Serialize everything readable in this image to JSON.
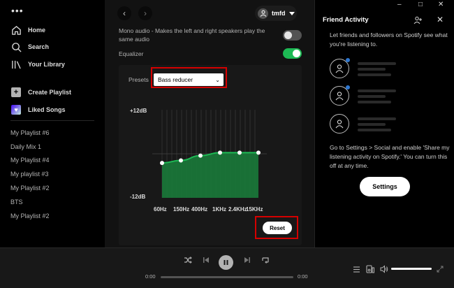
{
  "sidebar": {
    "nav": [
      {
        "label": "Home",
        "icon": "home-icon"
      },
      {
        "label": "Search",
        "icon": "search-icon"
      },
      {
        "label": "Your Library",
        "icon": "library-icon"
      }
    ],
    "actions": [
      {
        "label": "Create Playlist",
        "icon": "plus-icon"
      },
      {
        "label": "Liked Songs",
        "icon": "heart-icon"
      }
    ],
    "playlists": [
      "My Playlist #6",
      "Daily Mix 1",
      "My Playlist #4",
      "My playlist #3",
      "My Playlist #2",
      "BTS",
      "My Playlist #2"
    ]
  },
  "header": {
    "username": "tmfd"
  },
  "settings": {
    "mono_audio": {
      "label": "Mono audio - Makes the left and right speakers play the same audio",
      "enabled": false
    },
    "equalizer": {
      "label": "Equalizer",
      "enabled": true
    }
  },
  "equalizer": {
    "presets_label": "Presets",
    "preset_selected": "Bass reducer",
    "max_label": "+12dB",
    "min_label": "-12dB",
    "bands": [
      {
        "freq": "60Hz",
        "gain_db": -2.5
      },
      {
        "freq": "150Hz",
        "gain_db": -1.8
      },
      {
        "freq": "400Hz",
        "gain_db": -0.5
      },
      {
        "freq": "1KHz",
        "gain_db": 0.3
      },
      {
        "freq": "2.4KHz",
        "gain_db": 0.3
      },
      {
        "freq": "15KHz",
        "gain_db": 0.3
      }
    ],
    "range_db": [
      -12,
      12
    ],
    "reset_label": "Reset"
  },
  "friend_activity": {
    "title": "Friend Activity",
    "intro": "Let friends and followers on Spotify see what you're listening to.",
    "hint": "Go to Settings > Social and enable 'Share my listening activity on Spotify.' You can turn this off at any time.",
    "settings_label": "Settings"
  },
  "player": {
    "elapsed": "0:00",
    "duration": "0:00",
    "progress": 0,
    "volume": 1.0
  },
  "colors": {
    "accent": "#1db954",
    "highlight": "#d50000",
    "notification": "#2e77d0"
  }
}
